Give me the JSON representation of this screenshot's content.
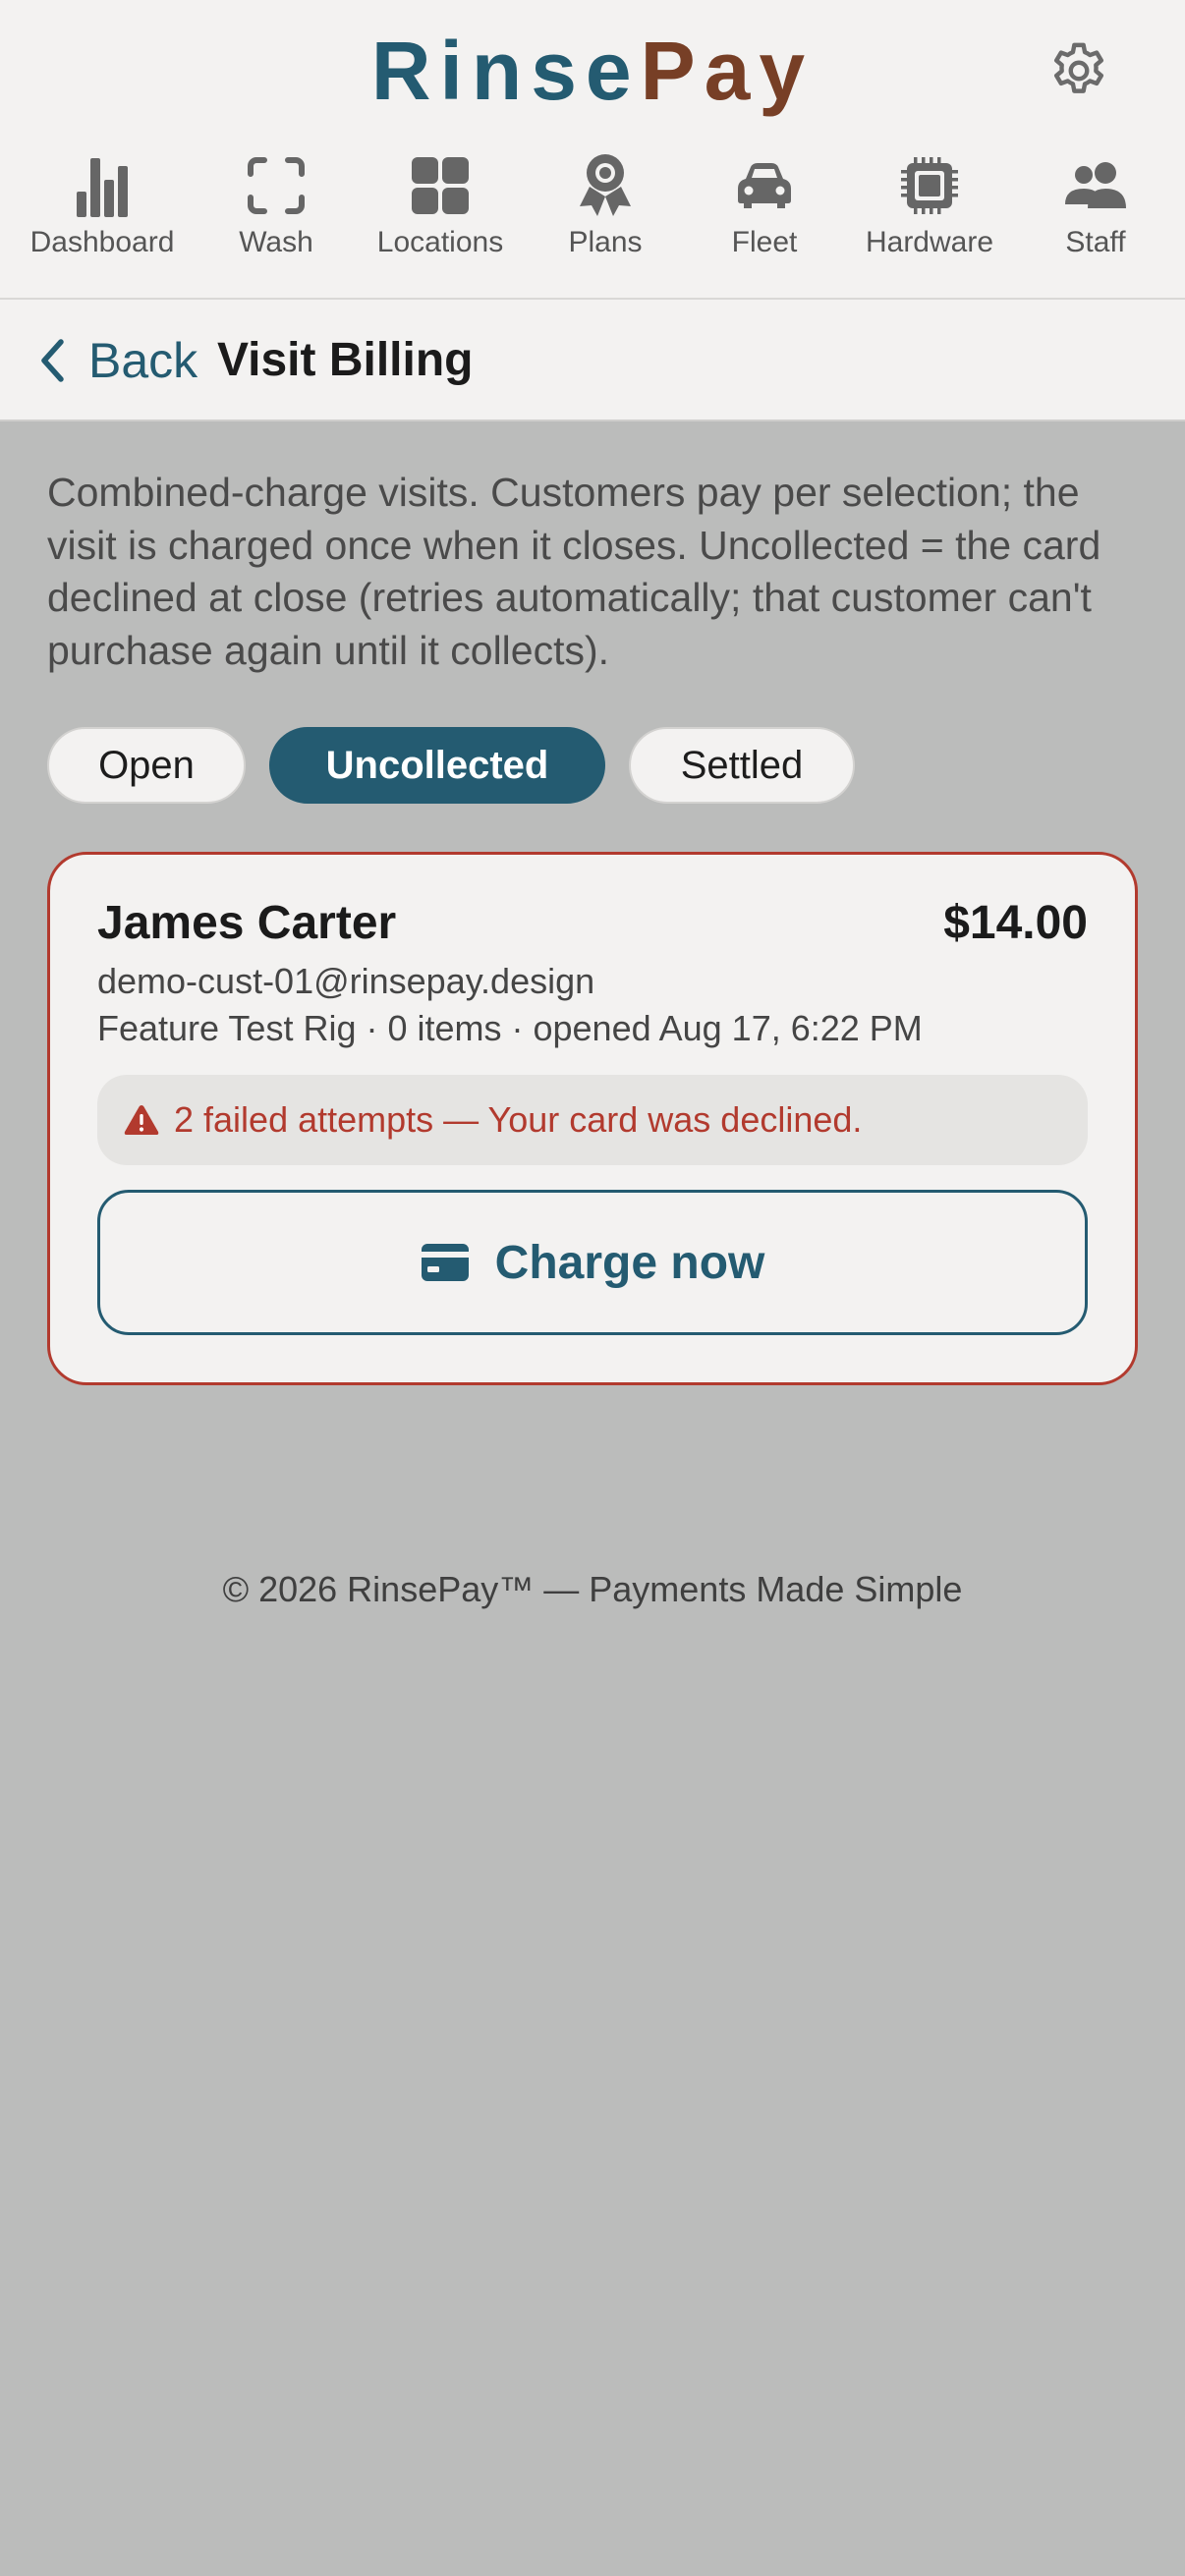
{
  "brand": {
    "part1": "Rinse",
    "part2": "Pay",
    "primary_color": "#245b71",
    "secondary_color": "#773f26"
  },
  "header": {
    "settings_icon": "gear-icon"
  },
  "nav": {
    "items": [
      {
        "label": "Dashboard",
        "icon": "bar-chart-icon"
      },
      {
        "label": "Wash",
        "icon": "scan-frame-icon"
      },
      {
        "label": "Locations",
        "icon": "grid-icon"
      },
      {
        "label": "Plans",
        "icon": "award-ribbon-icon"
      },
      {
        "label": "Fleet",
        "icon": "car-icon"
      },
      {
        "label": "Hardware",
        "icon": "chip-icon"
      },
      {
        "label": "Staff",
        "icon": "users-icon"
      }
    ]
  },
  "subheader": {
    "back_label": "Back",
    "title": "Visit Billing"
  },
  "intro": "Combined-charge visits. Customers pay per selection; the visit is charged once when it closes. Uncollected = the card declined at close (retries automatically; that customer can't purchase again until it collects).",
  "filters": {
    "items": [
      {
        "label": "Open",
        "active": false
      },
      {
        "label": "Uncollected",
        "active": true
      },
      {
        "label": "Settled",
        "active": false
      }
    ]
  },
  "visit": {
    "customer_name": "James Carter",
    "amount": "$14.00",
    "email": "demo-cust-01@rinsepay.design",
    "meta": "Feature Test Rig · 0 items · opened Aug 17, 6:22 PM",
    "alert": "2 failed attempts — Your card was declined.",
    "alert_color": "#b23a2e",
    "charge_label": "Charge now"
  },
  "footer": "© 2026 RinsePay™ — Payments Made Simple"
}
